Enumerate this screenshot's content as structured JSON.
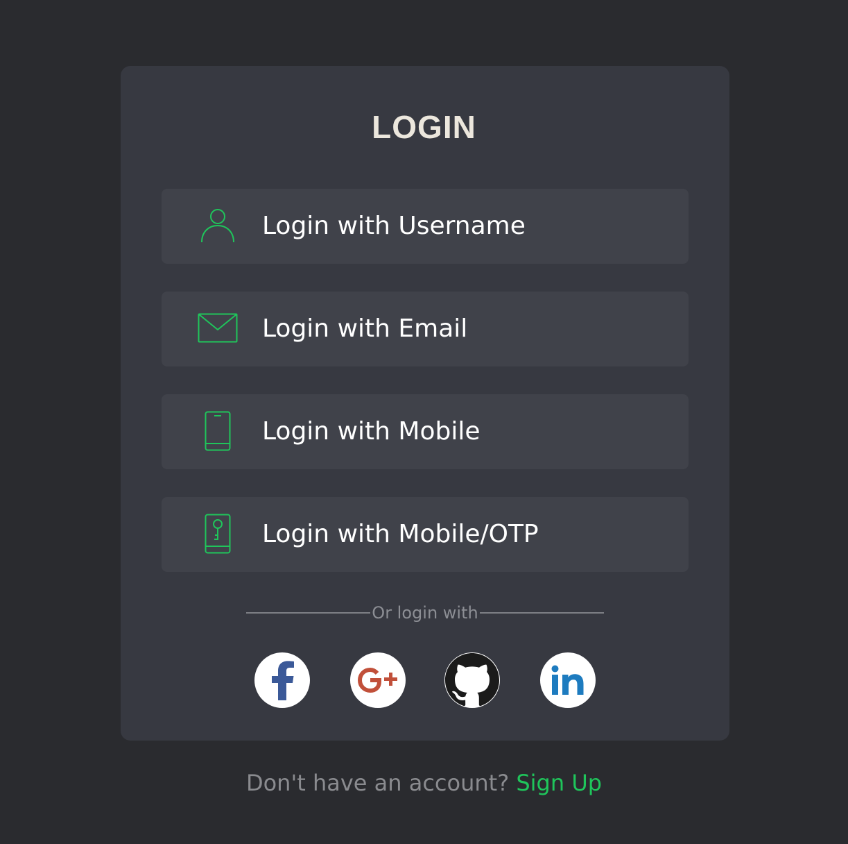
{
  "title": "LOGIN",
  "options": [
    {
      "label": "Login with Username",
      "icon": "user-icon"
    },
    {
      "label": "Login with Email",
      "icon": "envelope-icon"
    },
    {
      "label": "Login with Mobile",
      "icon": "mobile-phone-icon"
    },
    {
      "label": "Login with Mobile/OTP",
      "icon": "mobile-key-icon"
    }
  ],
  "divider_text": "Or login with",
  "social": [
    {
      "name": "facebook",
      "icon": "facebook-icon",
      "color": "#3b5998"
    },
    {
      "name": "google-plus",
      "icon": "google-plus-icon",
      "color": "#c1503a"
    },
    {
      "name": "github",
      "icon": "github-icon",
      "color": "#1b1b1b"
    },
    {
      "name": "linkedin",
      "icon": "linkedin-icon",
      "color": "#1d7bbf"
    }
  ],
  "footer": {
    "prompt": "Don't have an account?",
    "link": "Sign Up"
  },
  "colors": {
    "accent": "#1fc55b",
    "background": "#2a2b2f",
    "card": "#373941",
    "button": "#40424a"
  }
}
